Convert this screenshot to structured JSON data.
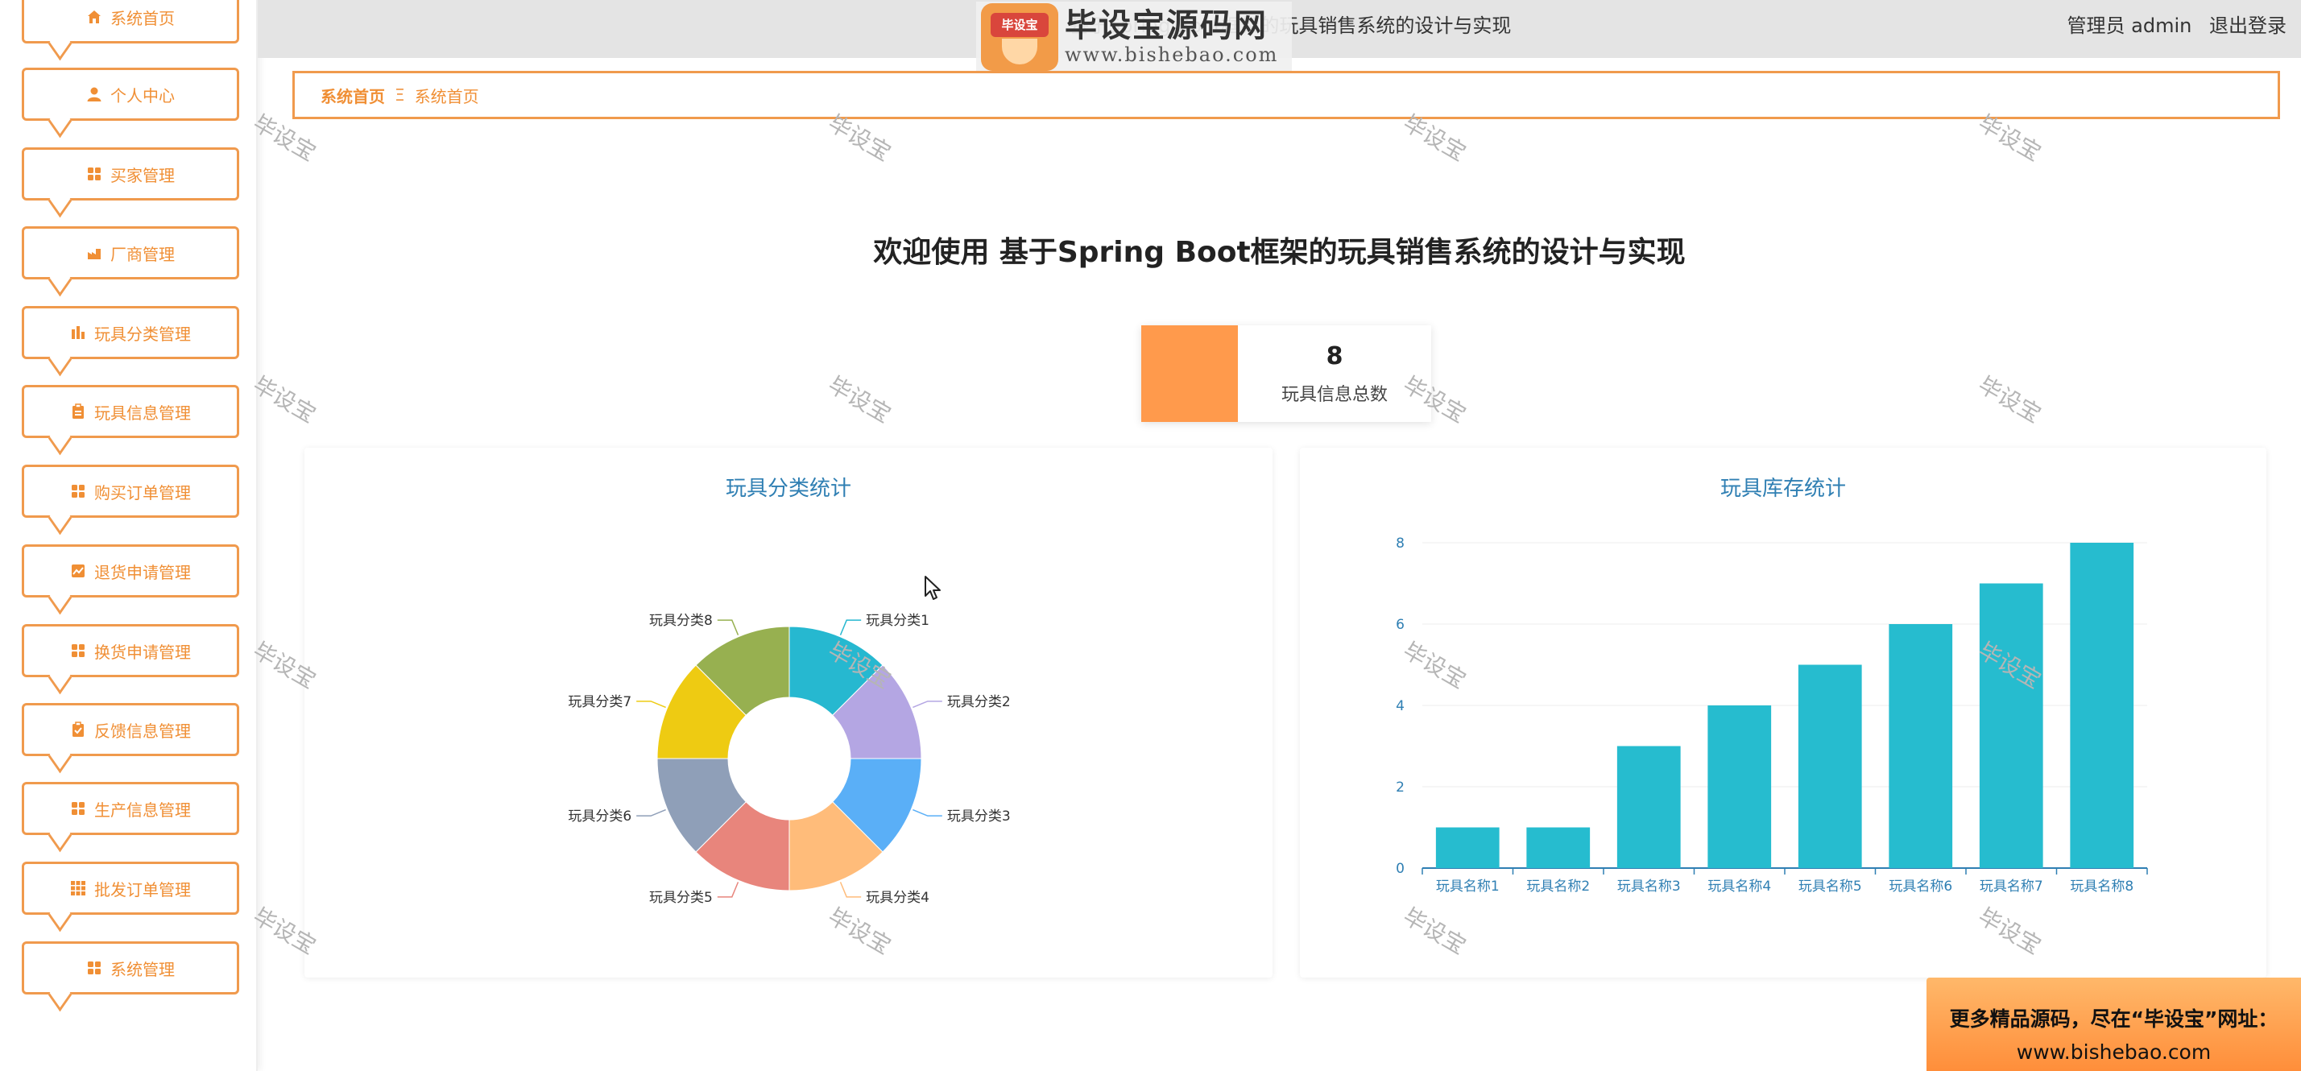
{
  "sidebar": {
    "items": [
      {
        "label": "系统首页",
        "icon": "home-icon"
      },
      {
        "label": "个人中心",
        "icon": "user-icon"
      },
      {
        "label": "买家管理",
        "icon": "grid-icon"
      },
      {
        "label": "厂商管理",
        "icon": "factory-icon"
      },
      {
        "label": "玩具分类管理",
        "icon": "chart-bars-icon"
      },
      {
        "label": "玩具信息管理",
        "icon": "clipboard-icon"
      },
      {
        "label": "购买订单管理",
        "icon": "grid-icon"
      },
      {
        "label": "退货申请管理",
        "icon": "line-chart-icon"
      },
      {
        "label": "换货申请管理",
        "icon": "grid-icon"
      },
      {
        "label": "反馈信息管理",
        "icon": "check-clipboard-icon"
      },
      {
        "label": "生产信息管理",
        "icon": "grid-icon"
      },
      {
        "label": "批发订单管理",
        "icon": "apps-icon"
      },
      {
        "label": "系统管理",
        "icon": "grid-icon"
      }
    ]
  },
  "topbar": {
    "title": "基于Spring Boot框架的玩具销售系统的设计与实现",
    "user_role": "管理员 admin",
    "logout": "退出登录"
  },
  "logo": {
    "badge": "毕设宝",
    "main": "毕设宝源码网",
    "url": "www.bishebao.com"
  },
  "breadcrumb": {
    "home": "系统首页",
    "separator": "Ξ",
    "current": "系统首页"
  },
  "welcome": "欢迎使用 基于Spring Boot框架的玩具销售系统的设计与实现",
  "stat": {
    "value": "8",
    "label": "玩具信息总数",
    "color": "#ff9a4c"
  },
  "watermark": "毕设宝",
  "ad": {
    "line1": "更多精品源码，尽在“毕设宝”网址：",
    "line2": "www.bishebao.com"
  },
  "chart_data": [
    {
      "type": "pie",
      "title": "玩具分类统计",
      "categories": [
        "玩具分类1",
        "玩具分类2",
        "玩具分类3",
        "玩具分类4",
        "玩具分类5",
        "玩具分类6",
        "玩具分类7",
        "玩具分类8"
      ],
      "values": [
        1,
        1,
        1,
        1,
        1,
        1,
        1,
        1
      ],
      "colors": [
        "#26b8d0",
        "#b4a6e3",
        "#5aaff7",
        "#ffbc7a",
        "#e8857c",
        "#8f9fb8",
        "#eecb12",
        "#97b050"
      ],
      "donut": true
    },
    {
      "type": "bar",
      "title": "玩具库存统计",
      "categories": [
        "玩具名称1",
        "玩具名称2",
        "玩具名称3",
        "玩具名称4",
        "玩具名称5",
        "玩具名称6",
        "玩具名称7",
        "玩具名称8"
      ],
      "values": [
        1,
        1,
        3,
        4,
        5,
        6,
        7,
        8
      ],
      "ylim": [
        0,
        8
      ],
      "yticks": [
        0,
        2,
        4,
        6,
        8
      ],
      "color": "#26bccf",
      "grid": true
    }
  ]
}
